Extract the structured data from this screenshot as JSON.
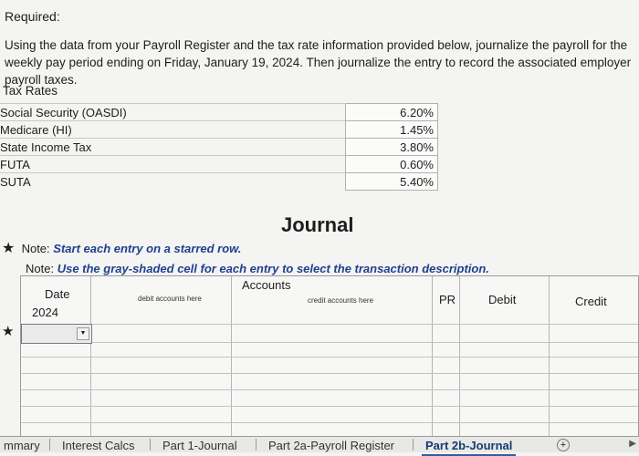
{
  "instructions": {
    "heading": "Required:",
    "body": "Using the data from your Payroll Register and the tax rate information provided below, journalize the payroll for the weekly pay period ending on Friday, January 19, 2024. Then journalize the entry to record the associated employer payroll taxes."
  },
  "tax_rates": {
    "title": "Tax Rates",
    "rows": [
      {
        "name": "Social Security (OASDI)",
        "rate": "6.20%"
      },
      {
        "name": "Medicare (HI)",
        "rate": "1.45%"
      },
      {
        "name": "State Income Tax",
        "rate": "3.80%"
      },
      {
        "name": "FUTA",
        "rate": "0.60%"
      },
      {
        "name": "SUTA",
        "rate": "5.40%"
      }
    ]
  },
  "journal": {
    "title": "Journal",
    "star_glyph": "★",
    "note1_prefix": "Note:",
    "note1_text": "Start each entry on a starred row.",
    "note2_prefix": "Note:",
    "note2_text": "Use the gray-shaded cell for each entry to select the transaction description.",
    "headers": {
      "date": "Date",
      "year": "2024",
      "accounts": "Accounts",
      "debit_accounts_hint": "debit accounts here",
      "credit_accounts_hint": "credit accounts here",
      "pr": "PR",
      "debit": "Debit",
      "credit": "Credit"
    }
  },
  "sheet_tabs": [
    {
      "label": "mmary",
      "active": false
    },
    {
      "label": "Interest Calcs",
      "active": false
    },
    {
      "label": "Part 1-Journal",
      "active": false
    },
    {
      "label": "Part 2a-Payroll Register",
      "active": false
    },
    {
      "label": "Part 2b-Journal",
      "active": true
    }
  ],
  "icons": {
    "add_sheet": "+",
    "scroll": "▶"
  }
}
